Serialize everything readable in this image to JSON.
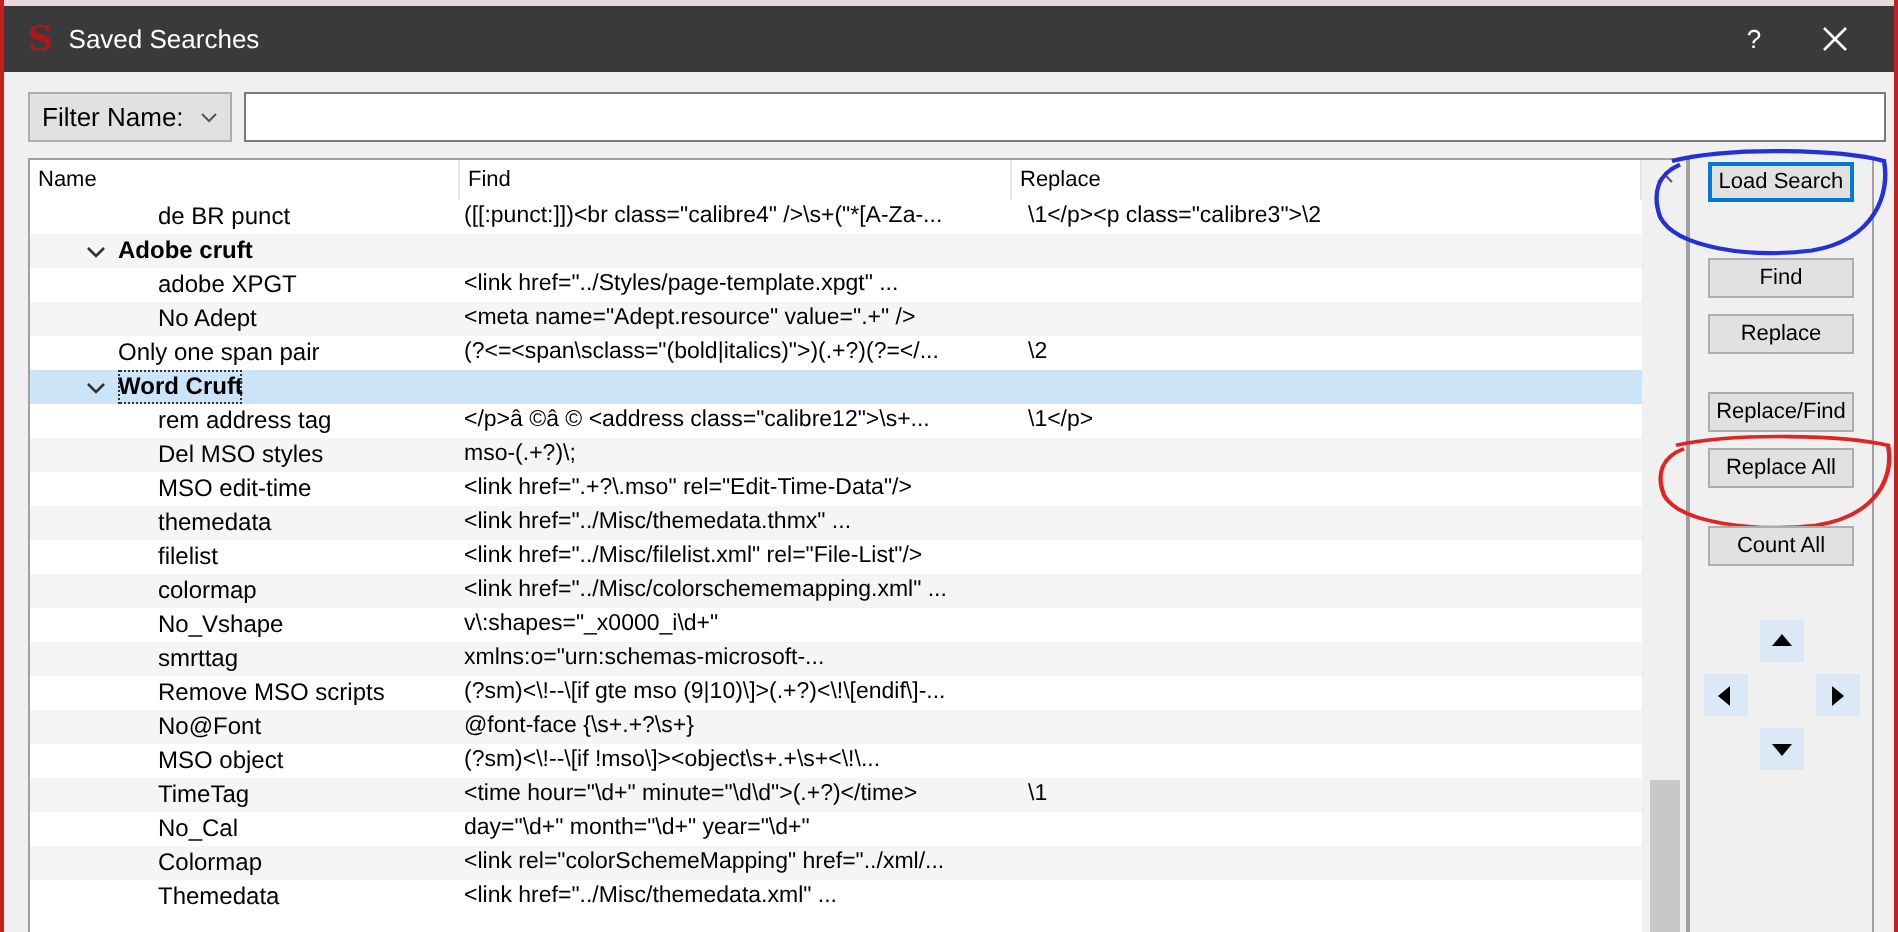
{
  "window": {
    "icon_letter": "S",
    "title": "Saved Searches",
    "help": "?"
  },
  "filter": {
    "mode": "Filter Name:"
  },
  "table": {
    "columns": [
      "Name",
      "Find",
      "Replace"
    ],
    "rows": [
      {
        "children": [
          {
            "name": "de BR punct",
            "find": "([[:punct:]])<br class=\"calibre4\" />\\s+(\"*[A-Za-...",
            "replace": "\\1</p><p class=\"calibre3\">\\2"
          }
        ]
      },
      {
        "name": "Adobe cruft",
        "selected": false,
        "expanded": true,
        "children": [
          {
            "name": "adobe XPGT",
            "find": "<link href=\"../Styles/page-template.xpgt\" ..."
          },
          {
            "name": "No Adept",
            "find": "<meta name=\"Adept.resource\" value=\".+\" />"
          }
        ]
      },
      {
        "name": "Only one span pair",
        "find": "(?<=<span\\sclass=\"(bold|italics)\">)(.+?)(?=</...",
        "replace": "\\2"
      },
      {
        "name": "Word Cruft",
        "selected": true,
        "expanded": true,
        "children": [
          {
            "name": "rem address tag",
            "find": "</p>â   ©â   ©  <address class=\"calibre12\">\\s+...",
            "replace": "\\1</p>"
          },
          {
            "name": "Del MSO styles",
            "find": "mso-(.+?)\\;"
          },
          {
            "name": "MSO edit-time",
            "find": "<link href=\".+?\\.mso\" rel=\"Edit-Time-Data\"/>"
          },
          {
            "name": "themedata",
            "find": "<link href=\"../Misc/themedata.thmx\" ..."
          },
          {
            "name": "filelist",
            "find": "<link href=\"../Misc/filelist.xml\" rel=\"File-List\"/>"
          },
          {
            "name": "colormap",
            "find": "<link href=\"../Misc/colorschememapping.xml\" ..."
          },
          {
            "name": "No_Vshape",
            "find": "v\\:shapes=\"_x0000_i\\d+\""
          },
          {
            "name": "smrttag",
            "find": "xmlns:o=\"urn:schemas-microsoft-..."
          },
          {
            "name": "Remove MSO scripts",
            "find": "(?sm)<\\!--\\[if gte mso (9|10)\\]>(.+?)<\\!\\[endif\\]-..."
          },
          {
            "name": "No@Font",
            "find": "@font-face {\\s+.+?\\s+}"
          },
          {
            "name": "MSO object",
            "find": "(?sm)<\\!--\\[if !mso\\]><object\\s+.+\\s+<\\!\\..."
          },
          {
            "name": "TimeTag",
            "find": "<time hour=\"\\d+\" minute=\"\\d\\d\">(.+?)</time>",
            "replace": "\\1"
          },
          {
            "name": "No_Cal",
            "find": "day=\"\\d+\" month=\"\\d+\" year=\"\\d+\""
          },
          {
            "name": "Colormap",
            "find": "<link rel=\"colorSchemeMapping\" href=\"../xml/..."
          },
          {
            "name": "Themedata",
            "find": "<link href=\"../Misc/themedata.xml\" ..."
          }
        ]
      }
    ]
  },
  "buttons": [
    {
      "label": "Load Search",
      "focused": true,
      "color": "#2430d8"
    },
    {
      "label": "Find",
      "focused": false
    },
    {
      "label": "Replace",
      "focused": false
    },
    {
      "label": "Replace/Find",
      "focused": false
    },
    {
      "label": "Replace All",
      "focused": false,
      "color": "#e02424"
    },
    {
      "label": "Count All",
      "focused": false
    }
  ],
  "move_buttons": [
    {
      "kind": "up"
    },
    {
      "kind": "left"
    },
    {
      "kind": "right"
    },
    {
      "kind": "down"
    }
  ]
}
